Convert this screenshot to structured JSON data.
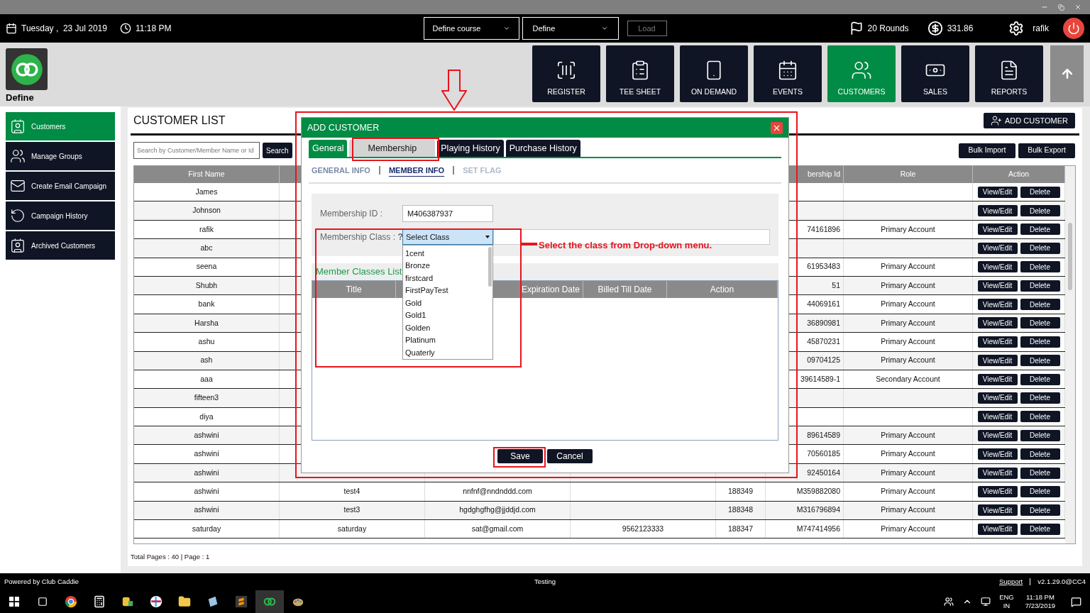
{
  "topbar": {
    "date": "Tuesday ,  23 Jul 2019",
    "time": "11:18 PM",
    "course_select": "Define course",
    "site_select": "Define",
    "load_button": {
      "label": "Load",
      "disabled": true
    },
    "rounds": "20 Rounds",
    "balance": "331.86",
    "user": "rafik"
  },
  "header": {
    "logo_label": "Define",
    "nav": [
      {
        "kind": "register",
        "label": "REGISTER",
        "selected": false
      },
      {
        "kind": "tee",
        "label": "TEE SHEET",
        "selected": false
      },
      {
        "kind": "demand",
        "label": "ON DEMAND",
        "selected": false
      },
      {
        "kind": "events",
        "label": "EVENTS",
        "selected": false
      },
      {
        "kind": "customers",
        "label": "CUSTOMERS",
        "selected": true
      },
      {
        "kind": "sales",
        "label": "SALES",
        "selected": false
      },
      {
        "kind": "reports",
        "label": "REPORTS",
        "selected": false
      }
    ]
  },
  "sidebar": [
    {
      "kind": "customers",
      "label": "Customers",
      "selected": true
    },
    {
      "kind": "groups",
      "label": "Manage Groups",
      "selected": false
    },
    {
      "kind": "email",
      "label": "Create Email Campaign",
      "selected": false
    },
    {
      "kind": "history",
      "label": "Campaign History",
      "selected": false
    },
    {
      "kind": "archived",
      "label": "Archived Customers",
      "selected": false
    }
  ],
  "customer_list": {
    "title": "CUSTOMER LIST",
    "add_button": "ADD CUSTOMER",
    "search": {
      "placeholder": "Search by Customer/Member Name or Id",
      "button": "Search"
    },
    "bulk_buttons": [
      "Bulk Import",
      "Bulk Export"
    ],
    "table": {
      "columns": {
        "first_name": "First Name",
        "membership_id": "bership Id",
        "role": "Role",
        "action": "Action"
      },
      "rows": [
        {
          "first_name": "James",
          "actions": [
            "View/Edit",
            "Delete"
          ]
        },
        {
          "first_name": "Johnson",
          "actions": [
            "View/Edit",
            "Delete"
          ]
        },
        {
          "first_name": "rafik",
          "membership_id": "74161896",
          "role": "Primary Account",
          "actions": [
            "View/Edit",
            "Delete"
          ]
        },
        {
          "first_name": "abc",
          "actions": [
            "View/Edit",
            "Delete"
          ]
        },
        {
          "first_name": "seena",
          "membership_id": "61953483",
          "role": "Primary Account",
          "actions": [
            "View/Edit",
            "Delete"
          ]
        },
        {
          "first_name": "Shubh",
          "membership_id": "51",
          "role": "Primary Account",
          "actions": [
            "View/Edit",
            "Delete"
          ]
        },
        {
          "first_name": "bank",
          "membership_id": "44069161",
          "role": "Primary Account",
          "actions": [
            "View/Edit",
            "Delete"
          ]
        },
        {
          "first_name": "Harsha",
          "membership_id": "36890981",
          "role": "Primary Account",
          "actions": [
            "View/Edit",
            "Delete"
          ]
        },
        {
          "first_name": "ashu",
          "membership_id": "45870231",
          "role": "Primary Account",
          "actions": [
            "View/Edit",
            "Delete"
          ]
        },
        {
          "first_name": "ash",
          "membership_id": "09704125",
          "role": "Primary Account",
          "actions": [
            "View/Edit",
            "Delete"
          ]
        },
        {
          "first_name": "aaa",
          "membership_id": "39614589-1",
          "role": "Secondary Account",
          "actions": [
            "View/Edit",
            "Delete"
          ]
        },
        {
          "first_name": "fifteen3",
          "actions": [
            "View/Edit",
            "Delete"
          ]
        },
        {
          "first_name": "diya",
          "actions": [
            "View/Edit",
            "Delete"
          ]
        },
        {
          "first_name": "ashwini",
          "membership_id": "89614589",
          "role": "Primary Account",
          "actions": [
            "View/Edit",
            "Delete"
          ]
        },
        {
          "first_name": "ashwini",
          "membership_id": "70560185",
          "role": "Primary Account",
          "actions": [
            "View/Edit",
            "Delete"
          ]
        },
        {
          "first_name": "ashwini",
          "membership_id": "92450164",
          "role": "Primary Account",
          "actions": [
            "View/Edit",
            "Delete"
          ]
        },
        {
          "first_name": "ashwini",
          "column_2": "test4",
          "column_3": "nnfnf@nndnddd.com",
          "column_5": "188349",
          "membership_id": "M359882080",
          "role": "Primary Account",
          "actions": [
            "View/Edit",
            "Delete"
          ]
        },
        {
          "first_name": "ashwini",
          "column_2": "test3",
          "column_3": "hgdghgfhg@jjddjd.com",
          "column_5": "188348",
          "membership_id": "M316796894",
          "role": "Primary Account",
          "actions": [
            "View/Edit",
            "Delete"
          ]
        },
        {
          "first_name": "saturday",
          "column_2": "saturday",
          "column_3": "sat@gmail.com",
          "column_4": "9562123333",
          "column_5": "188347",
          "membership_id": "M747414956",
          "role": "Primary Account",
          "actions": [
            "View/Edit",
            "Delete"
          ]
        }
      ]
    },
    "pagination": "Total Pages : 40 | Page : 1"
  },
  "dialog": {
    "title": "ADD CUSTOMER",
    "tabs": [
      {
        "label": "General",
        "color": "#008c44",
        "selected": false
      },
      {
        "label": "Membership",
        "color": "#d4d4d4",
        "selected": true
      },
      {
        "label": "Playing History",
        "color": "#0f1524",
        "selected": false
      },
      {
        "label": "Purchase History",
        "color": "#0f1524",
        "selected": false
      }
    ],
    "sub_tabs": [
      {
        "label": "GENERAL INFO",
        "selected": false,
        "disabled": false
      },
      {
        "label": "MEMBER INFO",
        "selected": true,
        "disabled": false
      },
      {
        "label": "SET FLAG",
        "selected": false,
        "disabled": true
      }
    ],
    "membership_id": {
      "label": "Membership ID :",
      "value": "M406387937"
    },
    "membership_class": {
      "label": "Membership Class : **?**",
      "value": "Select Class",
      "options": [
        "1cent",
        "Bronze",
        "firstcard",
        "FirstPayTest",
        "Gold",
        "Gold1",
        "Golden",
        "Platinum",
        "Quaterly"
      ]
    },
    "classes_list": {
      "title": "Member Classes List",
      "columns": [
        "Title",
        null,
        "Expiration Date",
        "Billed Till Date",
        "Action"
      ]
    },
    "buttons": [
      "Save",
      "Cancel"
    ]
  },
  "annotation": {
    "text": "Select the class from Drop-down menu."
  },
  "footer": {
    "powered": "Powered by Club Caddie",
    "environment": "Testing",
    "support_link": "Support",
    "version": "v2.1.29.0@CC4"
  },
  "taskbar": {
    "language": "ENG",
    "region": "IN",
    "time": "11:18 PM",
    "date": "7/23/2019"
  }
}
